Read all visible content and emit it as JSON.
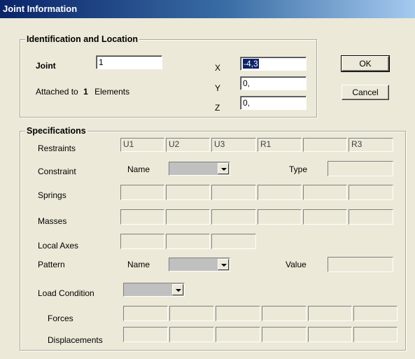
{
  "window": {
    "title": "Joint Information"
  },
  "identification": {
    "legend": "Identification and Location",
    "joint_label": "Joint",
    "joint_value": "1",
    "attached_prefix": "Attached to",
    "attached_count": "1",
    "attached_suffix": "Elements",
    "x_label": "X",
    "x_value": "-4,3",
    "y_label": "Y",
    "y_value": "0,",
    "z_label": "Z",
    "z_value": "0,"
  },
  "buttons": {
    "ok": "OK",
    "cancel": "Cancel"
  },
  "specifications": {
    "legend": "Specifications",
    "restraints_label": "Restraints",
    "restraints": [
      "U1",
      "U2",
      "U3",
      "R1",
      "",
      "R3"
    ],
    "constraint_label": "Constraint",
    "constraint_name_label": "Name",
    "constraint_type_label": "Type",
    "springs_label": "Springs",
    "masses_label": "Masses",
    "local_axes_label": "Local Axes",
    "pattern_label": "Pattern",
    "pattern_name_label": "Name",
    "pattern_value_label": "Value",
    "load_condition_label": "Load Condition",
    "forces_label": "Forces",
    "displacements_label": "Displacements"
  }
}
